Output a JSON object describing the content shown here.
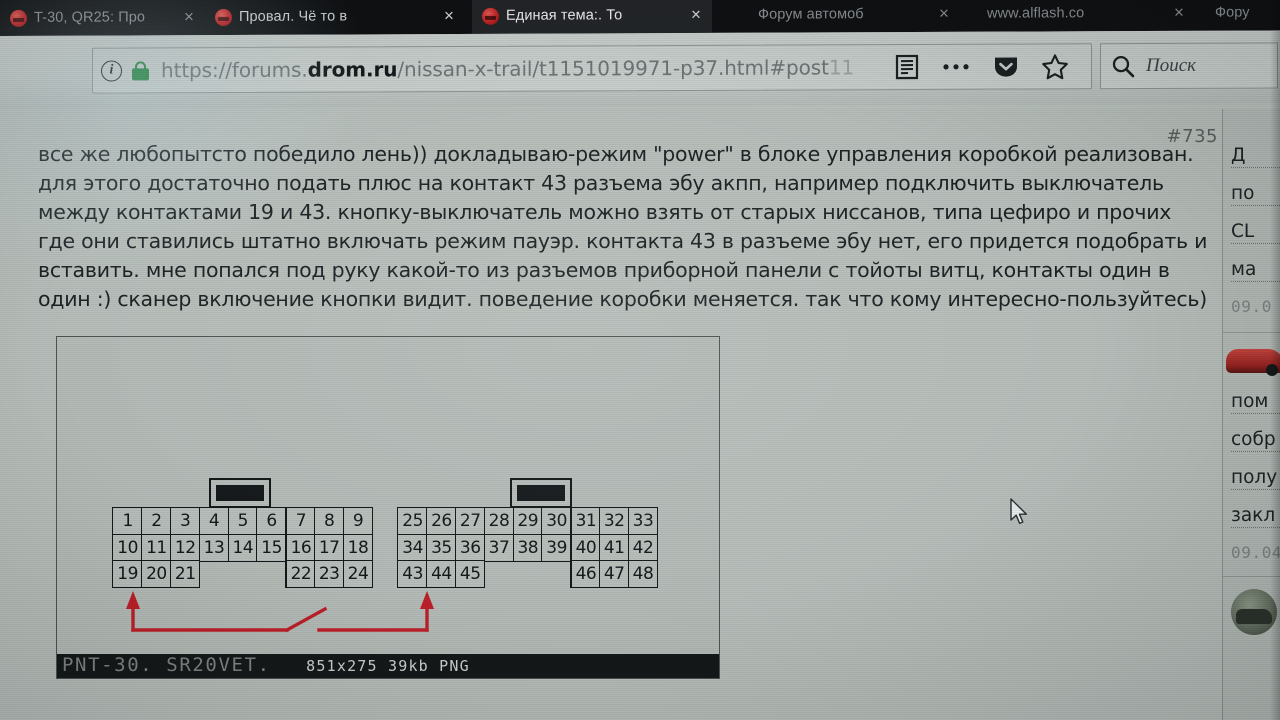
{
  "browser": {
    "tabs": [
      {
        "title": "T-30, QR25: Про",
        "close_label": "×",
        "active": false,
        "has_favicon": true,
        "dim": true
      },
      {
        "title": "Провал. Чё то в",
        "close_label": "×",
        "active": false,
        "has_favicon": true,
        "dim": false
      },
      {
        "title": "Единая тема:. То",
        "close_label": "×",
        "active": true,
        "has_favicon": true,
        "dim": false
      },
      {
        "title": "Форум автомоб",
        "close_label": "×",
        "active": false,
        "has_favicon": false,
        "dim": true
      },
      {
        "title": "www.alflash.co",
        "close_label": "×",
        "active": false,
        "has_favicon": false,
        "dim": true
      },
      {
        "title": "Фору",
        "close_label": "",
        "active": false,
        "has_favicon": false,
        "dim": true
      }
    ],
    "url": {
      "scheme": "https://",
      "host_prefix": "forums.",
      "host_strong": "drom.ru",
      "path": "/nissan-x-trail/t1151019971-p37.html#post",
      "path_faded": "11",
      "full": "https://forums.drom.ru/nissan-x-trail/t1151019971-p37.html#post11"
    },
    "toolbar": {
      "info_glyph": "i",
      "reader_icon": "reader-view-icon",
      "menu_icon": "page-actions-ellipsis-icon",
      "pocket_icon": "pocket-save-icon",
      "bookmark_icon": "bookmark-star-icon"
    },
    "search": {
      "placeholder": "Поиск",
      "icon": "search-icon"
    }
  },
  "post": {
    "number": "#735",
    "body": "все же любопытсто победило лень)) докладываю-режим \"power\" в блоке управления коробкой реализован. для этого достаточно подать плюс на контакт 43 разъема эбу акпп, например подключить выключатель между контактами 19 и 43. кнопку-выключатель можно взять от старых ниссанов, типа цефиро и прочих где они ставились штатно включать режим пауэр. контакта 43 в разъеме эбу нет, его придется подобрать и вставить. мне попался под руку какой-то из разъемов приборной панели с тойоты витц, контакты один в один :) сканер включение кнопки видит. поведение коробки меняется. так что кому интересно-пользуйтесь)",
    "signature": "PNT-30. SR20VET."
  },
  "attachment": {
    "caption": "851x275 39kb PNG",
    "connector_left": {
      "row1": [
        "1",
        "2",
        "3",
        "4",
        "5",
        "6",
        "7",
        "8",
        "9"
      ],
      "row2": [
        "10",
        "11",
        "12",
        "13",
        "14",
        "15",
        "16",
        "17",
        "18"
      ],
      "row3": [
        "19",
        "20",
        "21",
        "",
        "",
        "",
        "22",
        "23",
        "24"
      ]
    },
    "connector_right": {
      "row1": [
        "25",
        "26",
        "27",
        "28",
        "29",
        "30",
        "31",
        "32",
        "33"
      ],
      "row2": [
        "34",
        "35",
        "36",
        "37",
        "38",
        "39",
        "40",
        "41",
        "42"
      ],
      "row3": [
        "43",
        "44",
        "45",
        "",
        "",
        "",
        "46",
        "47",
        "48"
      ]
    },
    "annotation": {
      "color": "#cc1c27",
      "from_pin": "19",
      "to_pin": "43",
      "symbol": "switch"
    }
  },
  "sidebar": {
    "links_top": [
      "Д",
      "по",
      "CL",
      "ма"
    ],
    "date_top": "09.0",
    "links_bottom": [
      "пом",
      "собр",
      "полу",
      "закл"
    ],
    "date_bottom": "09.04",
    "car_thumb": "red-car-thumbnail",
    "avatar": "user-avatar"
  },
  "colors": {
    "page_bg": "#b7bfbb",
    "chrome_dark": "#0f1113",
    "accent_red": "#cc1c27",
    "lock_green": "#1d8a3c"
  }
}
